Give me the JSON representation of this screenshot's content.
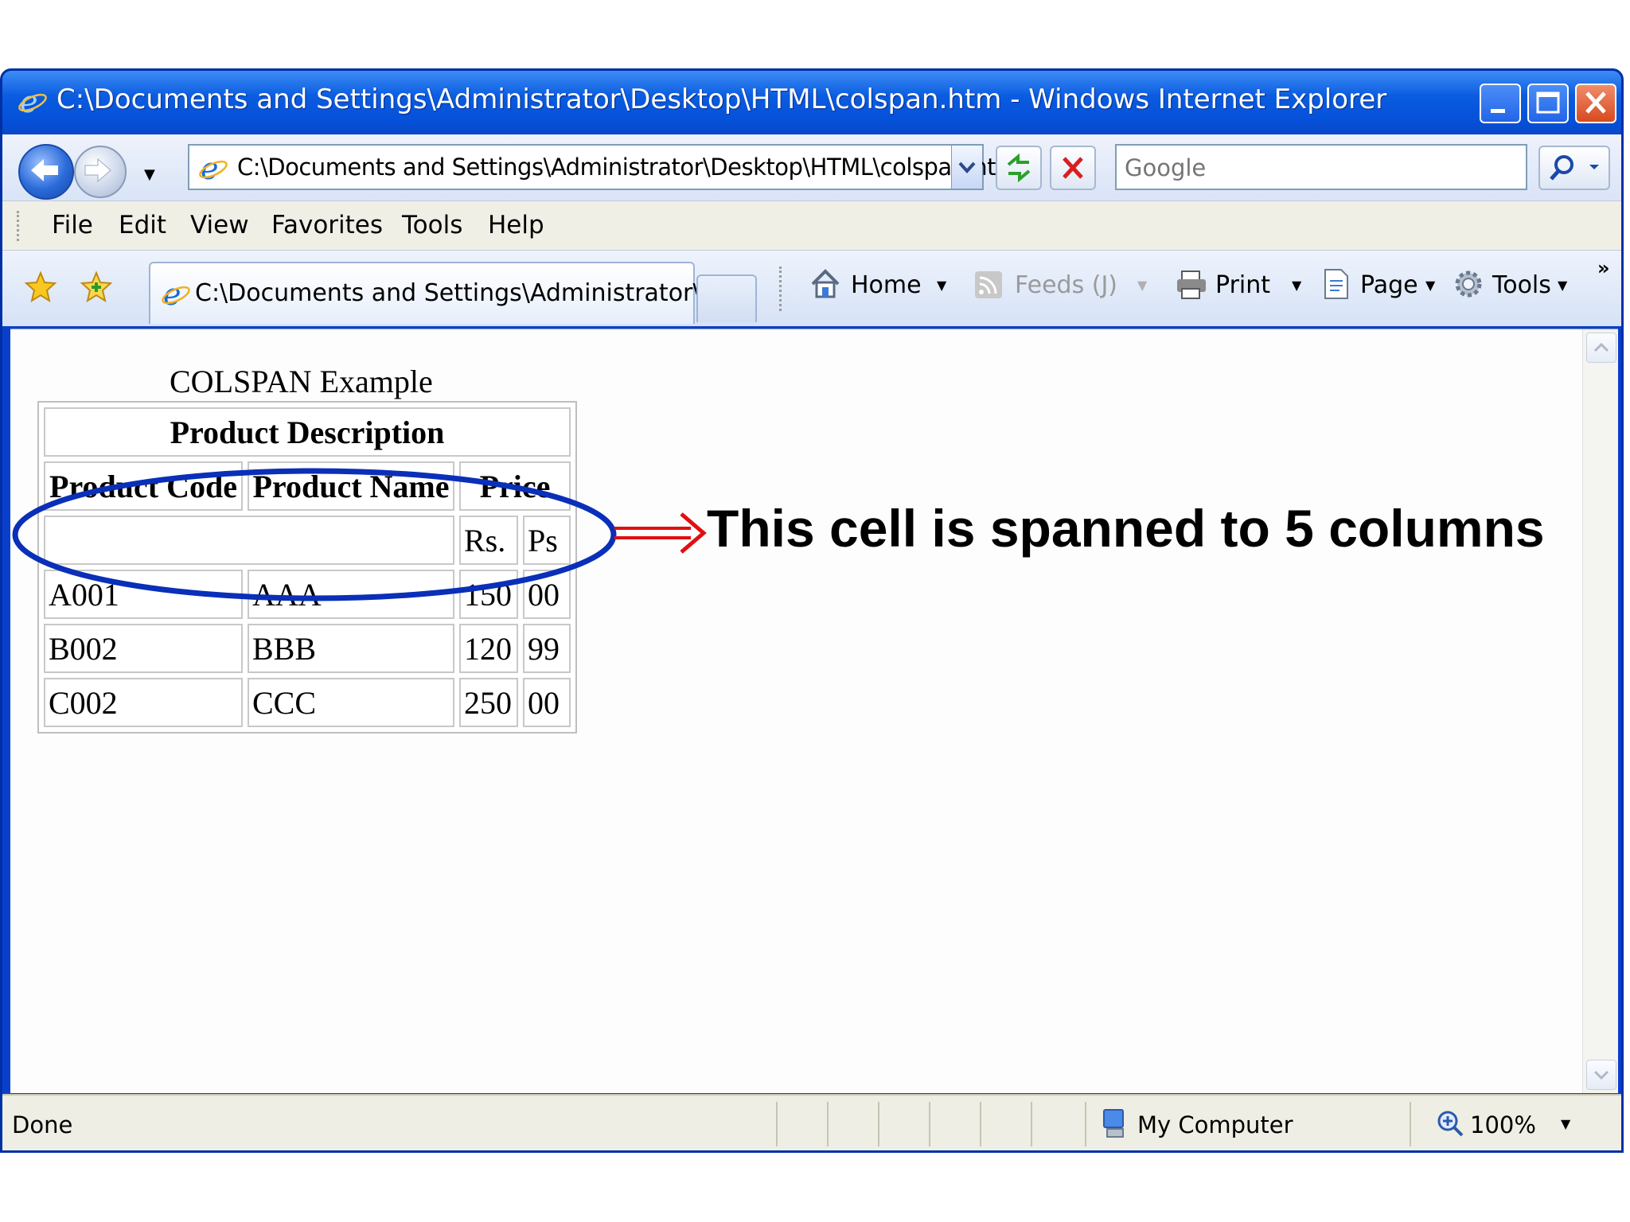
{
  "window": {
    "title": "C:\\Documents and Settings\\Administrator\\Desktop\\HTML\\colspan.htm - Windows Internet Explorer",
    "accent": "#0a5ce0"
  },
  "address": {
    "url": "C:\\Documents and Settings\\Administrator\\Desktop\\HTML\\colspan.htm",
    "search_placeholder": "Google"
  },
  "menu": [
    "File",
    "Edit",
    "View",
    "Favorites",
    "Tools",
    "Help"
  ],
  "tab": {
    "title": "C:\\Documents and Settings\\Administrator\\De..."
  },
  "toolbar": {
    "home": "Home",
    "feeds": "Feeds (J)",
    "print": "Print",
    "page": "Page",
    "tools": "Tools"
  },
  "page": {
    "heading": "COLSPAN Example",
    "table": {
      "caption_header": "Product Description",
      "headers": [
        "Product Code",
        "Product Name",
        "Price"
      ],
      "subheaders": [
        "Rs.",
        "Ps"
      ],
      "rows": [
        [
          "A001",
          "AAA",
          "150",
          "00"
        ],
        [
          "B002",
          "BBB",
          "120",
          "99"
        ],
        [
          "C002",
          "CCC",
          "250",
          "00"
        ]
      ]
    },
    "annotation": "This cell is spanned to 5 columns",
    "annotation_colors": {
      "ellipse": "#0a2fb8",
      "arrow": "#e01010"
    }
  },
  "status": {
    "text": "Done",
    "zone": "My Computer",
    "zoom": "100%"
  }
}
